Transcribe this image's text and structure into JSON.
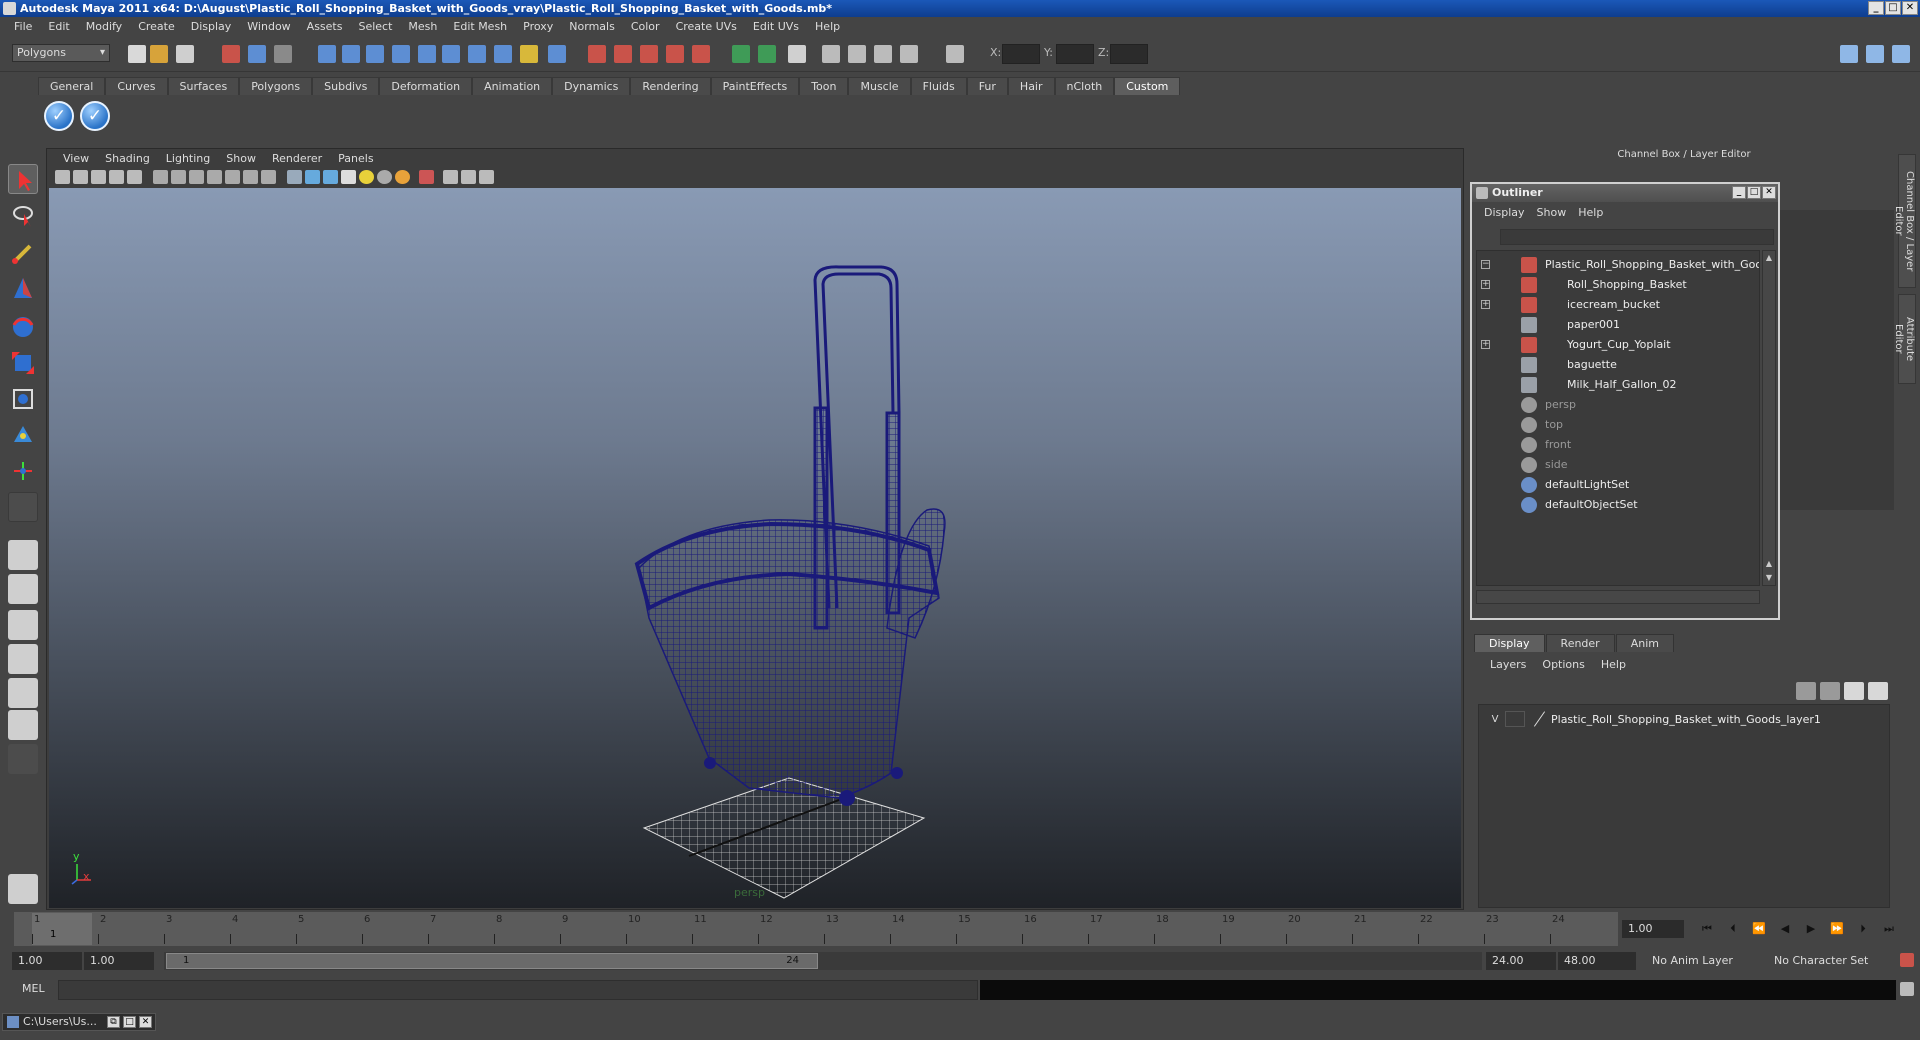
{
  "window": {
    "title": "Autodesk Maya 2011 x64: D:\\August\\Plastic_Roll_Shopping_Basket_with_Goods_vray\\Plastic_Roll_Shopping_Basket_with_Goods.mb*",
    "minimize": "_",
    "maximize": "□",
    "close": "✕"
  },
  "menubar": [
    "File",
    "Edit",
    "Modify",
    "Create",
    "Display",
    "Window",
    "Assets",
    "Select",
    "Mesh",
    "Edit Mesh",
    "Proxy",
    "Normals",
    "Color",
    "Create UVs",
    "Edit UVs",
    "Help"
  ],
  "statusline": {
    "mode": "Polygons",
    "x_label": "X:",
    "y_label": "Y:",
    "z_label": "Z:"
  },
  "shelf": {
    "tabs": [
      "General",
      "Curves",
      "Surfaces",
      "Polygons",
      "Subdivs",
      "Deformation",
      "Animation",
      "Dynamics",
      "Rendering",
      "PaintEffects",
      "Toon",
      "Muscle",
      "Fluids",
      "Fur",
      "Hair",
      "nCloth",
      "Custom"
    ],
    "active_tab": "Custom",
    "buttons": [
      "check-icon",
      "check-icon"
    ]
  },
  "viewport": {
    "menu": [
      "View",
      "Shading",
      "Lighting",
      "Show",
      "Renderer",
      "Panels"
    ],
    "camera_label": "persp",
    "axis_y": "y",
    "axis_x": "x",
    "wire_color": "#1a1a7a"
  },
  "channel_box": {
    "title": "Channel Box / Layer Editor",
    "side_tabs": [
      "Channel Box / Layer Editor",
      "Attribute Editor"
    ]
  },
  "outliner": {
    "title": "Outliner",
    "menu": [
      "Display",
      "Show",
      "Help"
    ],
    "items": [
      {
        "label": "Plastic_Roll_Shopping_Basket_with_Goods",
        "expand": "−",
        "depth": 0,
        "dim": false,
        "icon": "mesh-icon"
      },
      {
        "label": "Roll_Shopping_Basket",
        "expand": "+",
        "depth": 1,
        "dim": false,
        "icon": "mesh-icon"
      },
      {
        "label": "icecream_bucket",
        "expand": "+",
        "depth": 1,
        "dim": false,
        "icon": "mesh-icon"
      },
      {
        "label": "paper001",
        "expand": "",
        "depth": 1,
        "dim": false,
        "icon": "transform-icon"
      },
      {
        "label": "Yogurt_Cup_Yoplait",
        "expand": "+",
        "depth": 1,
        "dim": false,
        "icon": "mesh-icon"
      },
      {
        "label": "baguette",
        "expand": "",
        "depth": 1,
        "dim": false,
        "icon": "transform-icon"
      },
      {
        "label": "Milk_Half_Gallon_02",
        "expand": "",
        "depth": 1,
        "dim": false,
        "icon": "transform-icon"
      },
      {
        "label": "persp",
        "expand": "",
        "depth": 0,
        "dim": true,
        "icon": "camera-icon"
      },
      {
        "label": "top",
        "expand": "",
        "depth": 0,
        "dim": true,
        "icon": "camera-icon"
      },
      {
        "label": "front",
        "expand": "",
        "depth": 0,
        "dim": true,
        "icon": "camera-icon"
      },
      {
        "label": "side",
        "expand": "",
        "depth": 0,
        "dim": true,
        "icon": "camera-icon"
      },
      {
        "label": "defaultLightSet",
        "expand": "",
        "depth": 0,
        "dim": false,
        "icon": "set-icon"
      },
      {
        "label": "defaultObjectSet",
        "expand": "",
        "depth": 0,
        "dim": false,
        "icon": "set-icon"
      }
    ]
  },
  "layer_editor": {
    "tabs": [
      "Display",
      "Render",
      "Anim"
    ],
    "active_tab": "Display",
    "menu": [
      "Layers",
      "Options",
      "Help"
    ],
    "layers": [
      {
        "visible": "V",
        "name": "Plastic_Roll_Shopping_Basket_with_Goods_layer1"
      }
    ]
  },
  "timeline": {
    "ticks": [
      "1",
      "2",
      "3",
      "4",
      "5",
      "6",
      "7",
      "8",
      "9",
      "10",
      "11",
      "12",
      "13",
      "14",
      "15",
      "16",
      "17",
      "18",
      "19",
      "20",
      "21",
      "22",
      "23",
      "24"
    ],
    "current_frame": "1",
    "current_time": "1.00"
  },
  "range": {
    "start_time": "1.00",
    "playback_start": "1.00",
    "range_start": "1",
    "range_end": "24",
    "playback_end": "24.00",
    "end_time": "48.00",
    "anim_layer": "No Anim Layer",
    "character_set": "No Character Set"
  },
  "command_line": {
    "label": "MEL"
  },
  "taskbar": {
    "item": "C:\\Users\\Us..."
  }
}
